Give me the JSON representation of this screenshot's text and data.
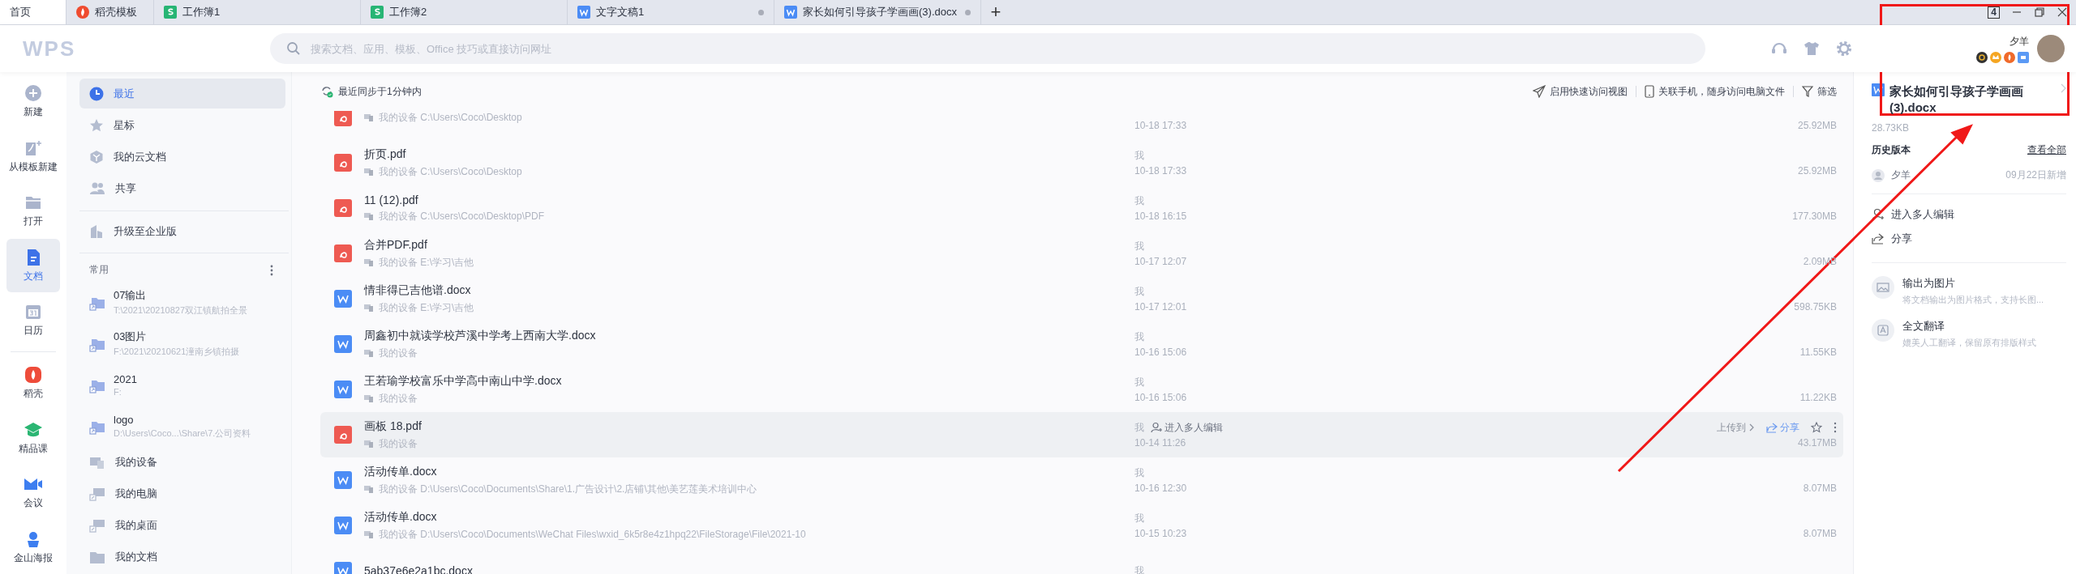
{
  "tabs": [
    {
      "label": "首页",
      "kind": "home",
      "selected": true,
      "unsaved": false
    },
    {
      "label": "稻壳模板",
      "kind": "daoke",
      "selected": false,
      "unsaved": false
    },
    {
      "label": "工作簿1",
      "kind": "sheet",
      "selected": false,
      "unsaved": false
    },
    {
      "label": "工作簿2",
      "kind": "sheet",
      "selected": false,
      "unsaved": false
    },
    {
      "label": "文字文稿1",
      "kind": "writer",
      "selected": false,
      "unsaved": true
    },
    {
      "label": "家长如何引导孩子学画画(3).docx",
      "kind": "writer",
      "selected": false,
      "unsaved": true
    }
  ],
  "new_tab": "+",
  "window_count": "4",
  "logo": "WPS",
  "search": {
    "placeholder": "搜索文档、应用、模板、Office 技巧或直接访问网址"
  },
  "user": {
    "name": "夕羊"
  },
  "nav": [
    {
      "label": "新建",
      "kind": "new",
      "selected": false
    },
    {
      "label": "从模板新建",
      "kind": "template",
      "selected": false
    },
    {
      "label": "打开",
      "kind": "open",
      "selected": false
    },
    {
      "label": "文档",
      "kind": "docs",
      "selected": true
    },
    {
      "label": "日历",
      "kind": "calendar",
      "selected": false
    },
    {
      "label": "稻壳",
      "kind": "daoke",
      "selected": false
    },
    {
      "label": "精品课",
      "kind": "course",
      "selected": false
    },
    {
      "label": "会议",
      "kind": "meeting",
      "selected": false
    },
    {
      "label": "金山海报",
      "kind": "poster",
      "selected": false
    }
  ],
  "sidebar": {
    "items": [
      {
        "label": "最近",
        "kind": "recent",
        "selected": true
      },
      {
        "label": "星标",
        "kind": "star",
        "selected": false
      },
      {
        "label": "我的云文档",
        "kind": "cloud",
        "selected": false
      },
      {
        "label": "共享",
        "kind": "share",
        "selected": false
      }
    ],
    "upgrade": "升级至企业版",
    "frequent_title": "常用",
    "folders": [
      {
        "name": "07输出",
        "path": "T:\\2021\\20210827双江镇航拍全景"
      },
      {
        "name": "03图片",
        "path": "F:\\2021\\20210621潼南乡镇拍摄"
      },
      {
        "name": "2021",
        "path": "F:"
      },
      {
        "name": "logo",
        "path": "D:\\Users\\Coco...\\Share\\7.公司资料"
      }
    ],
    "places": [
      {
        "label": "我的设备",
        "kind": "devices"
      },
      {
        "label": "我的电脑",
        "kind": "computer"
      },
      {
        "label": "我的桌面",
        "kind": "desktop"
      },
      {
        "label": "我的文档",
        "kind": "documents"
      }
    ]
  },
  "file_list": {
    "sync_status": "最近同步于1分钟内",
    "actions": [
      {
        "label": "启用快速访问视图",
        "kind": "send"
      },
      {
        "label": "关联手机，随身访问电脑文件",
        "kind": "phone"
      },
      {
        "label": "筛选",
        "kind": "filter"
      }
    ],
    "rows": [
      {
        "kind": "pdf",
        "location": "我的设备 C:\\Users\\Coco\\Desktop",
        "time": "10-18 17:33",
        "size": "25.92MB",
        "selected": false
      },
      {
        "kind": "pdf",
        "name": "折页.pdf",
        "location": "我的设备 C:\\Users\\Coco\\Desktop",
        "owner": "我",
        "time": "10-18 17:33",
        "size": "25.92MB",
        "selected": false
      },
      {
        "kind": "pdf",
        "name": "11 (12).pdf",
        "location": "我的设备 C:\\Users\\Coco\\Desktop\\PDF",
        "owner": "我",
        "time": "10-18 16:15",
        "size": "177.30MB",
        "selected": false
      },
      {
        "kind": "pdf",
        "name": "合并PDF.pdf",
        "location": "我的设备 E:\\学习\\吉他",
        "owner": "我",
        "time": "10-17 12:07",
        "size": "2.09MB",
        "selected": false
      },
      {
        "kind": "word",
        "name": "情非得已吉他谱.docx",
        "location": "我的设备 E:\\学习\\吉他",
        "owner": "我",
        "time": "10-17 12:01",
        "size": "598.75KB",
        "selected": false
      },
      {
        "kind": "word",
        "name": "周鑫初中就读学校芦溪中学考上西南大学.docx",
        "location": "我的设备",
        "owner": "我",
        "time": "10-16 15:06",
        "size": "11.55KB",
        "selected": false
      },
      {
        "kind": "word",
        "name": "王若瑜学校富乐中学高中南山中学.docx",
        "location": "我的设备",
        "owner": "我",
        "time": "10-16 15:06",
        "size": "11.22KB",
        "selected": false
      },
      {
        "kind": "pdf",
        "name": "画板 18.pdf",
        "location": "我的设备",
        "owner": "我",
        "collab": "进入多人编辑",
        "time": "10-14 11:26",
        "size": "43.17MB",
        "selected": true,
        "upload": "上传到",
        "share": "分享"
      },
      {
        "kind": "word",
        "name": "活动传单.docx",
        "location": "我的设备 D:\\Users\\Coco\\Documents\\Share\\1.广告设计\\2.店铺\\其他\\美艺莲美术培训中心",
        "owner": "我",
        "time": "10-16 12:30",
        "size": "8.07MB",
        "selected": false
      },
      {
        "kind": "word",
        "name": "活动传单.docx",
        "location": "我的设备 D:\\Users\\Coco\\Documents\\WeChat Files\\wxid_6k5r8e4z1hpq22\\FileStorage\\File\\2021-10",
        "owner": "我",
        "time": "10-15 10:23",
        "size": "8.07MB",
        "selected": false
      },
      {
        "kind": "word",
        "name": "5ab37e6e2a1bc.docx",
        "owner": "我",
        "selected": false
      }
    ]
  },
  "detail": {
    "title": "家长如何引导孩子学画画(3).docx",
    "size": "28.73KB",
    "history_title": "历史版本",
    "history_link": "查看全部",
    "history": [
      {
        "user": "夕羊",
        "note": "09月22日新增"
      }
    ],
    "actions": [
      {
        "label": "进入多人编辑",
        "kind": "collab"
      },
      {
        "label": "分享",
        "kind": "share"
      }
    ],
    "tools": [
      {
        "title": "输出为图片",
        "desc": "将文档输出为图片格式，支持长图...",
        "kind": "image"
      },
      {
        "title": "全文翻译",
        "desc": "媲美人工翻译，保留原有排版样式",
        "kind": "translate"
      }
    ]
  }
}
